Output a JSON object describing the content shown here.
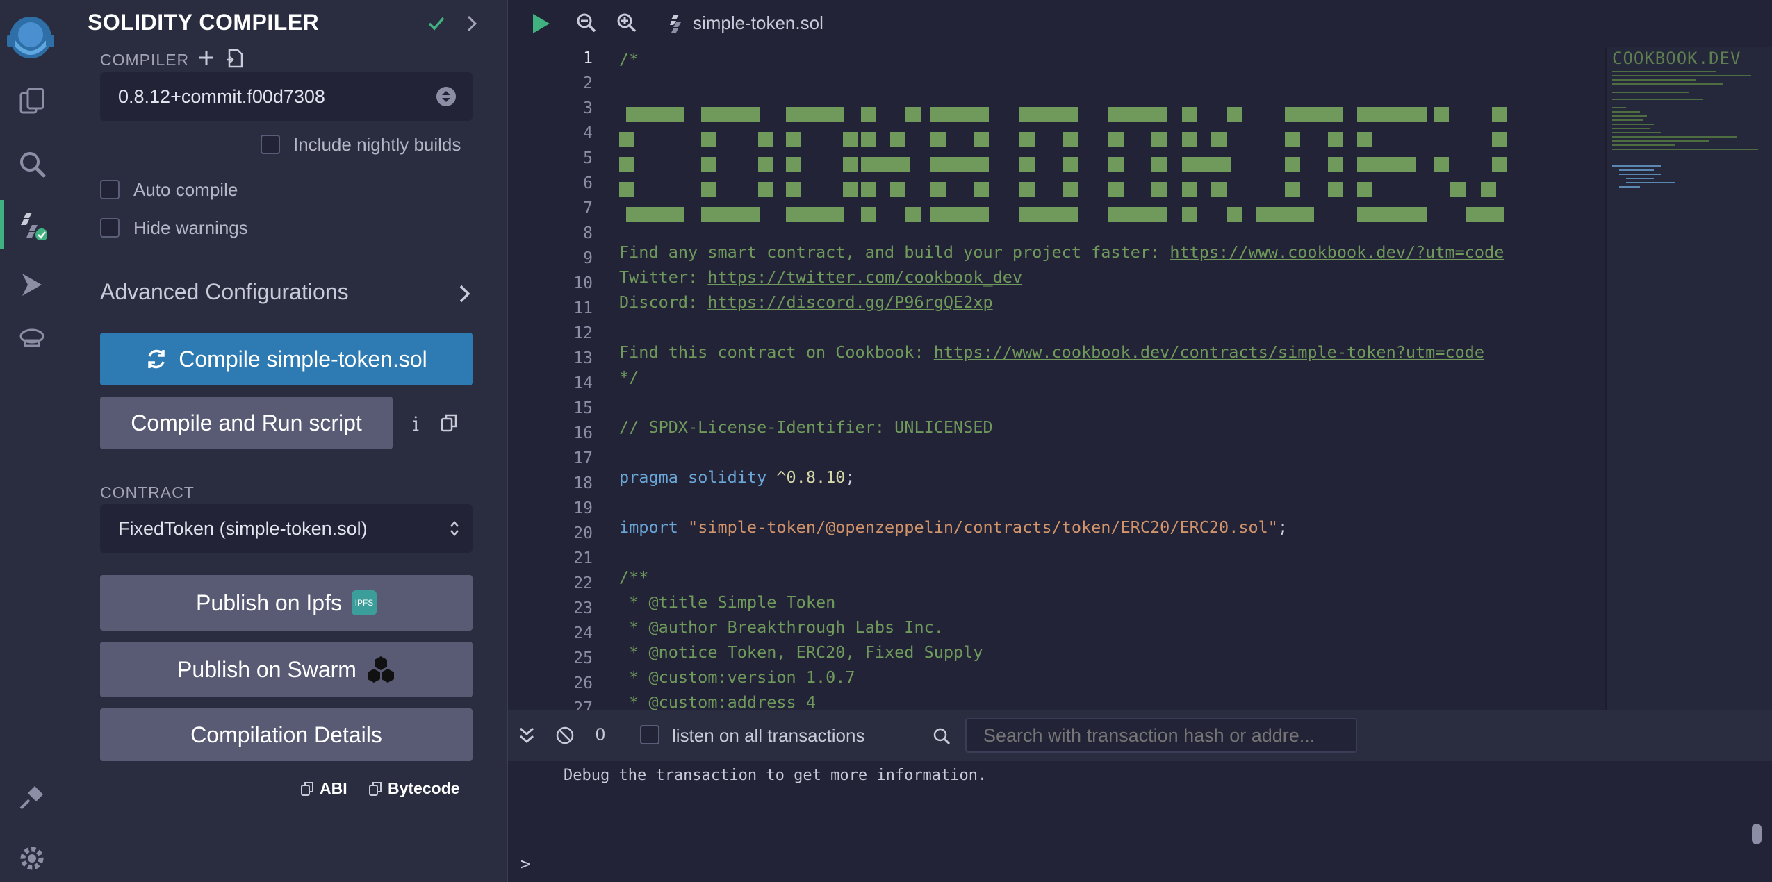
{
  "sidebar": {
    "title": "SOLIDITY COMPILER",
    "compiler_label": "COMPILER",
    "compiler_version": "0.8.12+commit.f00d7308",
    "nightly_label": "Include nightly builds",
    "auto_compile_label": "Auto compile",
    "hide_warnings_label": "Hide warnings",
    "advanced_label": "Advanced Configurations",
    "compile_button": "Compile simple-token.sol",
    "compile_run_button": "Compile and Run script",
    "contract_label": "CONTRACT",
    "contract_value": "FixedToken (simple-token.sol)",
    "publish_ipfs": "Publish on Ipfs",
    "ipfs_badge": "IPFS",
    "publish_swarm": "Publish on Swarm",
    "compilation_details": "Compilation Details",
    "abi_label": "ABI",
    "bytecode_label": "Bytecode"
  },
  "toolbar": {
    "filename": "simple-token.sol"
  },
  "editor": {
    "line_numbers": [
      "1",
      "2",
      "3",
      "4",
      "5",
      "6",
      "7",
      "8",
      "9",
      "10",
      "11",
      "12",
      "13",
      "14",
      "15",
      "16",
      "17",
      "18",
      "19",
      "20",
      "21",
      "22",
      "23",
      "24",
      "25",
      "26",
      "27"
    ],
    "banner_text": "COOKBOOK.DEV",
    "line1": "/*",
    "line9_text": "Find any smart contract, and build your project faster: ",
    "line9_link": "https://www.cookbook.dev/?utm=code",
    "line10_text": "Twitter: ",
    "line10_link": "https://twitter.com/cookbook_dev",
    "line11_text": "Discord: ",
    "line11_link": "https://discord.gg/P96rgQE2xp",
    "line13_text": "Find this contract on Cookbook: ",
    "line13_link": "https://www.cookbook.dev/contracts/simple-token?utm=code",
    "line14": "*/",
    "line16": "// SPDX-License-Identifier: UNLICENSED",
    "line18_kw1": "pragma",
    "line18_kw2": "solidity",
    "line18_rest": "^0.8.10",
    "line18_semi": ";",
    "line20_kw": "import",
    "line20_str": "\"simple-token/@openzeppelin/contracts/token/ERC20/ERC20.sol\"",
    "line20_semi": ";",
    "line22": "/**",
    "line23": " * @title Simple Token",
    "line24": " * @author Breakthrough Labs Inc.",
    "line25": " * @notice Token, ERC20, Fixed Supply",
    "line26": " * @custom:version 1.0.7",
    "line27": " * @custom:address 4"
  },
  "terminal": {
    "count": "0",
    "listen_label": "listen on all transactions",
    "search_placeholder": "Search with transaction hash or addre...",
    "message": "Debug the transaction to get more information.",
    "prompt": ">"
  },
  "colors": {
    "accent": "#2e7bb3",
    "success": "#3fb27f",
    "comment_green": "#6f9a5b"
  }
}
